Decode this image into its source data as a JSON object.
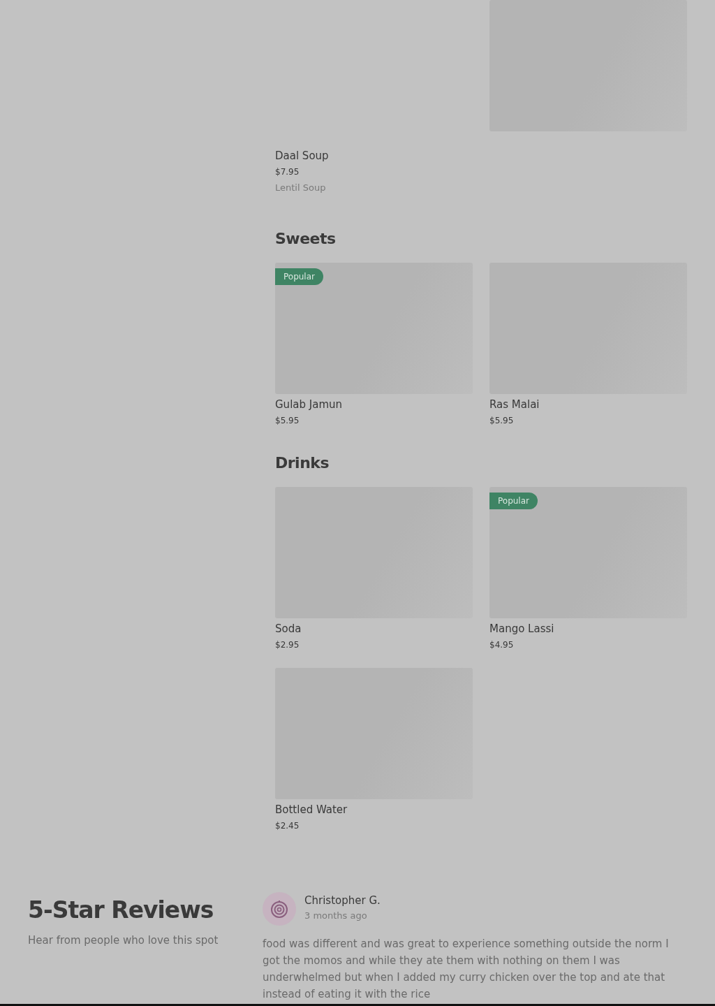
{
  "top_item": {
    "name": "Daal Soup",
    "price": "$7.95",
    "description": "Lentil Soup"
  },
  "sections": [
    {
      "title": "Sweets",
      "items": [
        {
          "name": "Gulab Jamun",
          "price": "$5.95",
          "badge": "Popular"
        },
        {
          "name": "Ras Malai",
          "price": "$5.95"
        }
      ]
    },
    {
      "title": "Drinks",
      "items": [
        {
          "name": "Soda",
          "price": "$2.95"
        },
        {
          "name": "Mango Lassi",
          "price": "$4.95",
          "badge": "Popular"
        },
        {
          "name": "Bottled Water",
          "price": "$2.45"
        }
      ]
    }
  ],
  "reviews": {
    "title": "5-Star Reviews",
    "subtitle": "Hear from people who love this spot",
    "items": [
      {
        "author": "Christopher G.",
        "time": "3 months ago",
        "text": "food was different and was great to experience something outside the norm I got the momos and while they ate them with nothing on them I was underwhelmed but when I added my curry chicken over the top and ate that instead of eating it with the rice"
      }
    ]
  }
}
